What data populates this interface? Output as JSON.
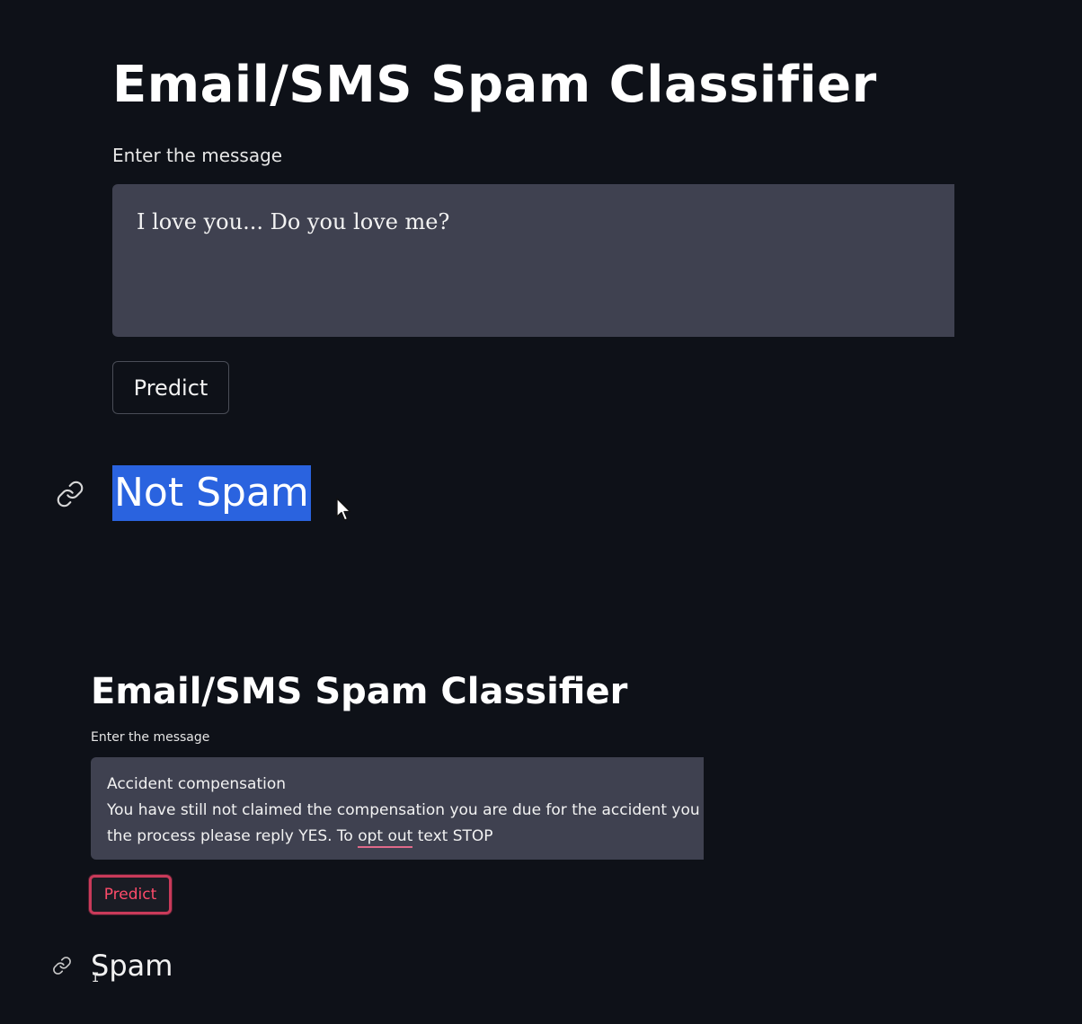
{
  "panel1": {
    "title": "Email/SMS Spam Classifier",
    "input_label": "Enter the message",
    "message": "I love you... Do you love me?",
    "button_label": "Predict",
    "result": "Not Spam"
  },
  "panel2": {
    "title": "Email/SMS Spam Classifier",
    "input_label": "Enter the message",
    "message_line1": "Accident compensation",
    "message_line2": "You have still not claimed the compensation you are due for the accident you had.",
    "message_line3_before": "the process please reply YES. To ",
    "message_line3_underlined": "opt out",
    "message_line3_after": " text STOP",
    "button_label": "Predict",
    "result": "Spam"
  },
  "icons": {
    "link": "link-icon",
    "cursor": "mouse-pointer-icon",
    "text_cursor": "text-cursor-icon"
  },
  "colors": {
    "background": "#0e1118",
    "textarea_bg": "#3f4150",
    "selection": "#2a63df",
    "predict_focus_border": "#c93a5a",
    "predict_focus_text": "#ff4b6a"
  }
}
